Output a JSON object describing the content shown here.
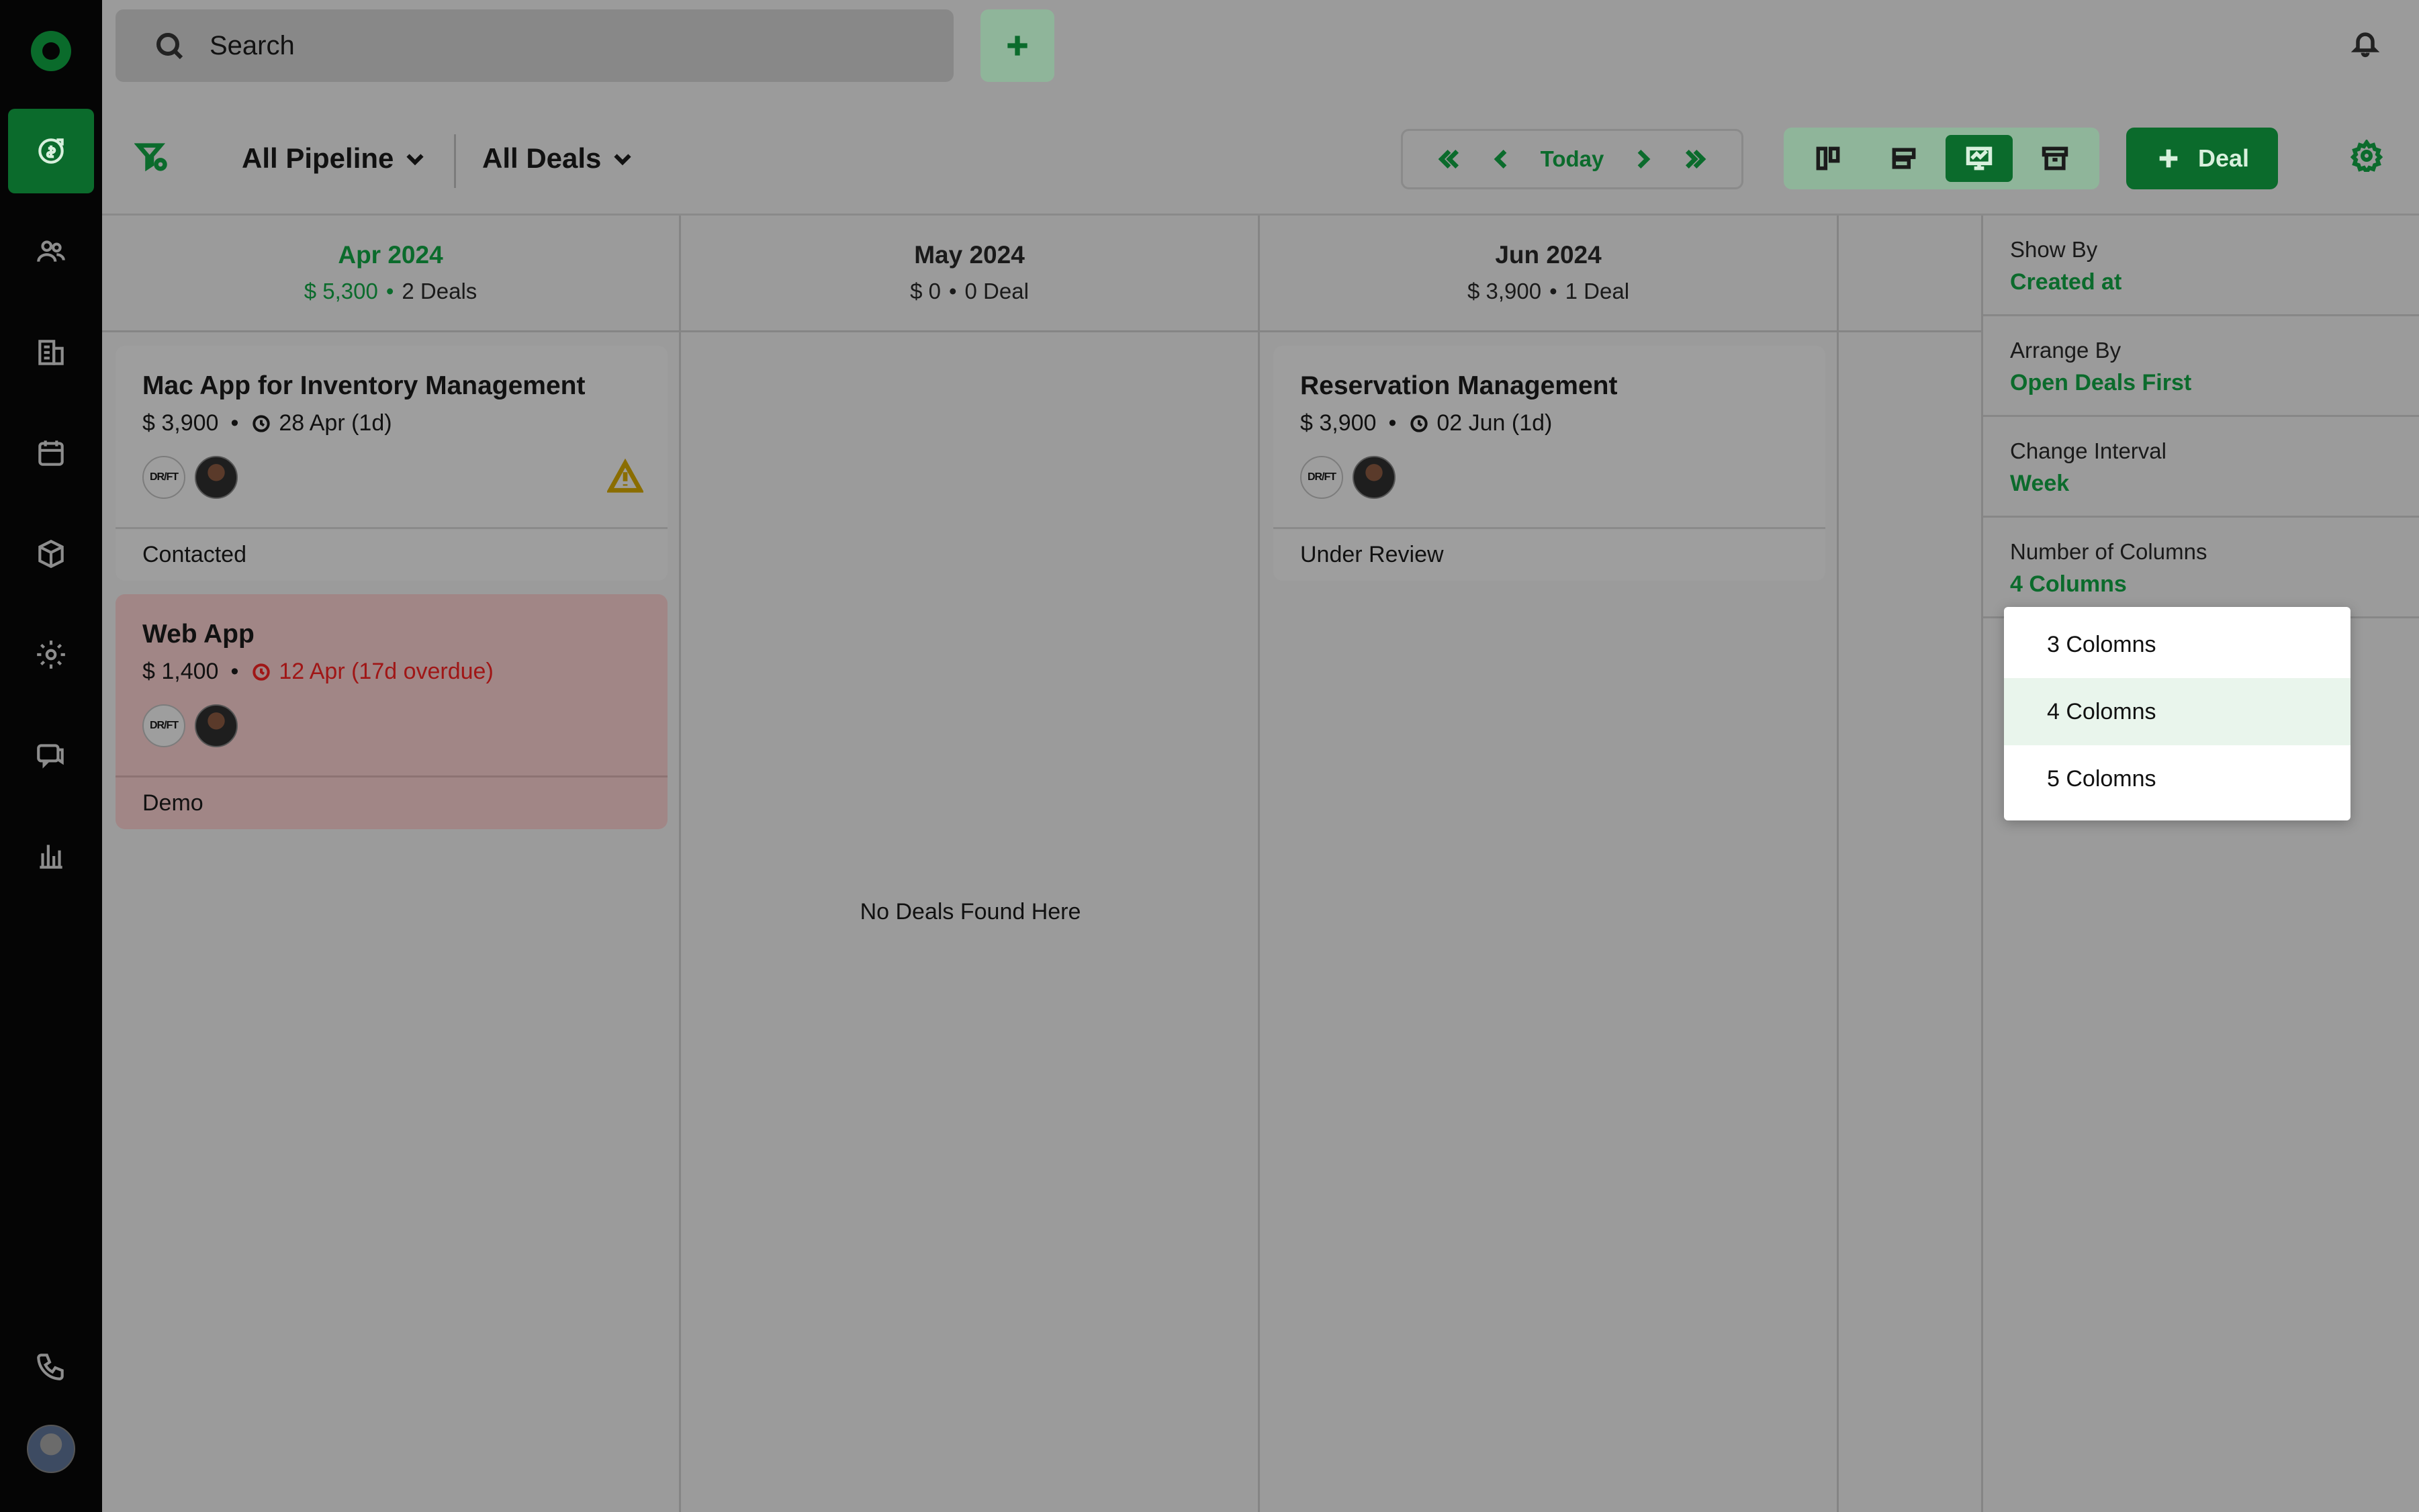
{
  "search": {
    "placeholder": "Search"
  },
  "toolbar": {
    "pipeline_label": "All Pipeline",
    "deals_filter_label": "All Deals",
    "today_label": "Today",
    "deal_button_label": "Deal"
  },
  "columns": [
    {
      "title": "Apr 2024",
      "amount": "$ 5,300",
      "count": "2 Deals",
      "highlight": true,
      "cards": [
        {
          "title": "Mac App for Inventory Management",
          "amount": "$ 3,900",
          "due": "28 Apr (1d)",
          "stage": "Contacted",
          "overdue": false,
          "warning": true
        },
        {
          "title": "Web App",
          "amount": "$ 1,400",
          "due": "12 Apr (17d overdue)",
          "stage": "Demo",
          "overdue": true,
          "warning": false
        }
      ]
    },
    {
      "title": "May 2024",
      "amount": "$ 0",
      "count": "0 Deal",
      "highlight": false,
      "empty_text": "No Deals Found Here",
      "cards": []
    },
    {
      "title": "Jun 2024",
      "amount": "$ 3,900",
      "count": "1 Deal",
      "highlight": false,
      "cards": [
        {
          "title": "Reservation Management",
          "amount": "$ 3,900",
          "due": "02 Jun (1d)",
          "stage": "Under Review",
          "overdue": false,
          "warning": false
        }
      ]
    }
  ],
  "avatar_logo_text": "DR/FT",
  "panel": {
    "show_by": {
      "label": "Show By",
      "value": "Created at"
    },
    "arrange_by": {
      "label": "Arrange By",
      "value": "Open Deals First"
    },
    "change_interval": {
      "label": "Change Interval",
      "value": "Week"
    },
    "number_of_columns": {
      "label": "Number of Columns",
      "value": "4 Columns"
    }
  },
  "column_menu": {
    "options": [
      "3 Colomns",
      "4 Colomns",
      "5 Colomns"
    ],
    "selected_index": 1
  },
  "colors": {
    "accent": "#0b6b2c",
    "overdue_text": "#a01616",
    "overlay_gray": "#9b9b9b"
  },
  "icons": {
    "sidebar": [
      "deals-icon",
      "contacts-icon",
      "companies-icon",
      "calendar-icon",
      "products-icon",
      "settings-icon",
      "chat-icon",
      "reports-icon",
      "phone-icon"
    ]
  }
}
